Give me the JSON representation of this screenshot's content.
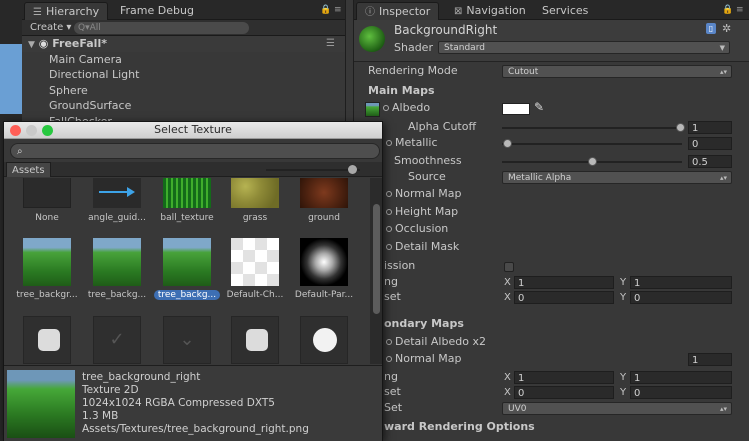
{
  "hierarchy": {
    "tab_label": "Hierarchy",
    "frame_debug_label": "Frame Debug",
    "create_label": "Create ▾",
    "search_placeholder": "Q▾All",
    "scene": "FreeFall*",
    "items": [
      "Main Camera",
      "Directional Light",
      "Sphere",
      "GroundSurface",
      "FallChecker"
    ]
  },
  "inspector": {
    "tabs": [
      "Inspector",
      "Navigation",
      "Services"
    ],
    "material_name": "BackgroundRight",
    "shader_label": "Shader",
    "shader_value": "Standard",
    "rendering_mode_label": "Rendering Mode",
    "rendering_mode_value": "Cutout",
    "main_maps_label": "Main Maps",
    "albedo_label": "Albedo",
    "alpha_cutoff_label": "Alpha Cutoff",
    "alpha_cutoff_value": "1",
    "metallic_label": "Metallic",
    "metallic_value": "0",
    "smoothness_label": "Smoothness",
    "smoothness_value": "0.5",
    "source_label": "Source",
    "source_value": "Metallic Alpha",
    "normal_map_label": "Normal Map",
    "height_map_label": "Height Map",
    "occlusion_label": "Occlusion",
    "detail_mask_label": "Detail Mask",
    "emission_label": "ission",
    "tiling_label": "ng",
    "offset_label": "set",
    "x_label": "X",
    "y_label": "Y",
    "tiling_x": "1",
    "tiling_y": "1",
    "offset_x": "0",
    "offset_y": "0",
    "secondary_maps_label": "ondary Maps",
    "detail_albedo_label": "Detail Albedo x2",
    "sec_normal_map_label": "Normal Map",
    "sec_normal_value": "1",
    "sec_tiling_label": "ng",
    "sec_offset_label": "set",
    "sec_tiling_x": "1",
    "sec_tiling_y": "1",
    "sec_offset_x": "0",
    "sec_offset_y": "0",
    "uv_set_label": "Set",
    "uv_set_value": "UV0",
    "forward_label": "ward Rendering Options"
  },
  "dialog": {
    "title": "Select Texture",
    "assets_tab": "Assets",
    "textures": [
      {
        "label": "None",
        "thumb": "none"
      },
      {
        "label": "angle_guid...",
        "thumb": "arrow"
      },
      {
        "label": "ball_texture",
        "thumb": "ball"
      },
      {
        "label": "grass",
        "thumb": "grass"
      },
      {
        "label": "ground",
        "thumb": "ground"
      },
      {
        "label": "tree_backgr...",
        "thumb": "tree"
      },
      {
        "label": "tree_backg...",
        "thumb": "tree"
      },
      {
        "label": "tree_backg...",
        "thumb": "tree",
        "selected": true
      },
      {
        "label": "Default-Ch...",
        "thumb": "checker"
      },
      {
        "label": "Default-Par...",
        "thumb": "particle"
      },
      {
        "label": "",
        "thumb": "ui-knob"
      },
      {
        "label": "",
        "thumb": "ui-check"
      },
      {
        "label": "",
        "thumb": "ui-dropdown"
      },
      {
        "label": "",
        "thumb": "ui-knob"
      },
      {
        "label": "",
        "thumb": "ui-circle"
      }
    ],
    "info": {
      "name": "tree_background_right",
      "type": "Texture 2D",
      "format": "1024x1024  RGBA Compressed DXT5",
      "size": "1.3 MB",
      "path": "Assets/Textures/tree_background_right.png"
    }
  },
  "colors": {
    "selection": "#3d6fb4",
    "traffic_close": "#ff5f57",
    "traffic_min": "#febc2e",
    "traffic_max": "#28c840"
  }
}
